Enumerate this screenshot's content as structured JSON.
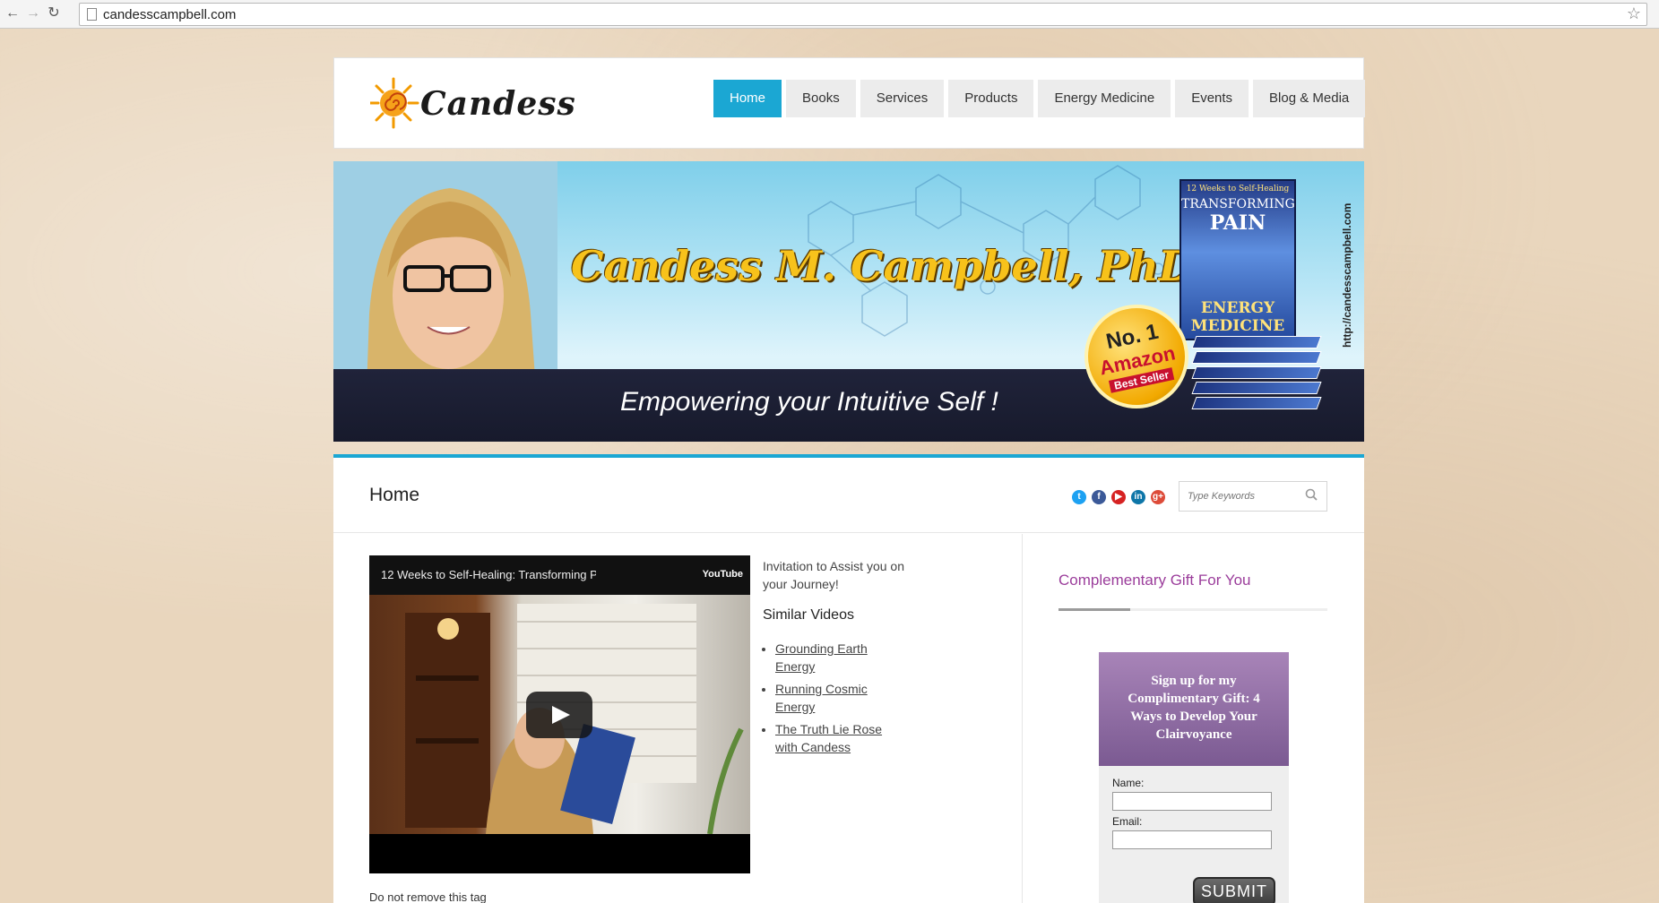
{
  "browser": {
    "url": "candesscampbell.com"
  },
  "header": {
    "logo_text": "Candess",
    "menu": [
      {
        "label": "Home",
        "active": true
      },
      {
        "label": "Books",
        "active": false
      },
      {
        "label": "Services",
        "active": false
      },
      {
        "label": "Products",
        "active": false
      },
      {
        "label": "Energy Medicine",
        "active": false
      },
      {
        "label": "Events",
        "active": false
      },
      {
        "label": "Blog & Media",
        "active": false
      }
    ]
  },
  "banner": {
    "title": "Candess M. Campbell, PhD",
    "tagline": "Empowering your Intuitive Self !",
    "site_url": "http://candesscampbell.com",
    "badge": {
      "line1": "No. 1",
      "line2": "Amazon",
      "line3": "Best Seller"
    },
    "book": {
      "top": "12 Weeks to Self-Healing",
      "line1": "TRANSFORMING",
      "line2": "PAIN",
      "line3": "ENERGY MEDICINE"
    }
  },
  "page": {
    "title": "Home",
    "search_placeholder": "Type Keywords",
    "social_icons": [
      "twitter-icon",
      "facebook-icon",
      "youtube-icon",
      "linkedin-icon",
      "google-plus-icon"
    ]
  },
  "video": {
    "title": "12 Weeks to Self-Healing: Transforming P",
    "provider": "YouTube",
    "caption": "Do not remove this tag"
  },
  "side_text": {
    "invite": "Invitation to Assist you on your Journey!",
    "similar_heading": "Similar Videos",
    "similar": [
      "Grounding Earth Energy",
      "Running Cosmic Energy",
      "The Truth Lie Rose with Candess"
    ]
  },
  "sidebar": {
    "gift_heading": "Complementary Gift For You",
    "optin_heading": "Sign up for my Complimentary Gift: 4 Ways to Develop Your Clairvoyance",
    "name_label": "Name:",
    "email_label": "Email:",
    "submit_label": "SUBMIT"
  },
  "colors": {
    "accent": "#1ba7d3",
    "gift_heading": "#9b3d9b",
    "optin_header": "#8d6ba3"
  }
}
